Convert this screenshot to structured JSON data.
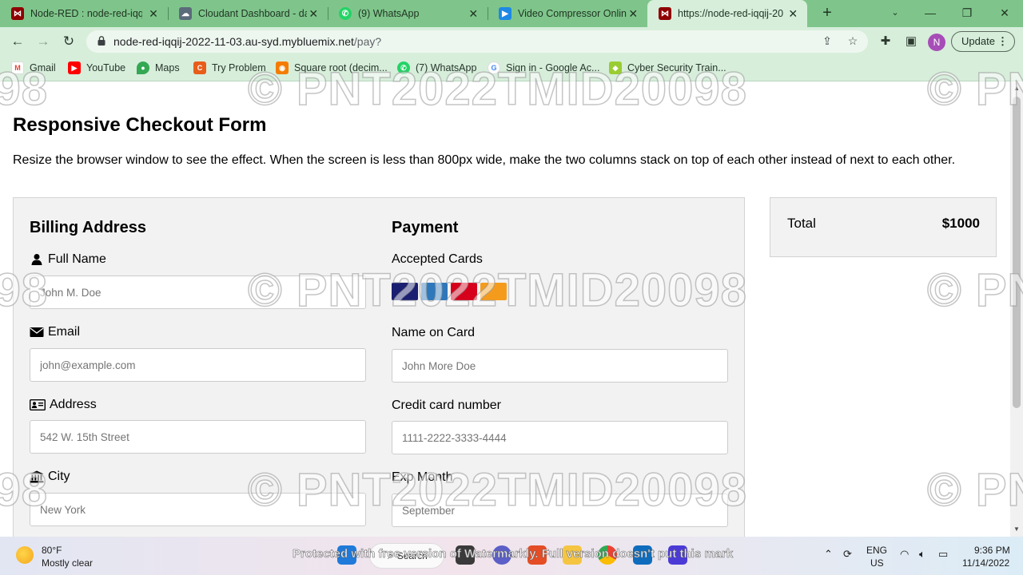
{
  "browser": {
    "tabs": [
      {
        "label": "Node-RED : node-red-iqqij",
        "icon": "node-red-icon",
        "color": "#8f0000"
      },
      {
        "label": "Cloudant Dashboard - dat",
        "icon": "cloudant-icon",
        "color": "#5a6b7a"
      },
      {
        "label": "(9) WhatsApp",
        "icon": "whatsapp-icon",
        "color": "#25d366"
      },
      {
        "label": "Video Compressor Online",
        "icon": "video-compressor-icon",
        "color": "#1e88e5"
      },
      {
        "label": "https://node-red-iqqij-20",
        "icon": "node-red-icon",
        "color": "#8f0000"
      }
    ],
    "url_host": "node-red-iqqij-2022-11-03.au-syd.mybluemix.net",
    "url_path": "/pay?",
    "profile_initial": "N",
    "update_label": "Update",
    "bookmarks": [
      {
        "label": "Gmail",
        "icon": "gmail-icon",
        "color": "#ea4335"
      },
      {
        "label": "YouTube",
        "icon": "youtube-icon",
        "color": "#ff0000"
      },
      {
        "label": "Maps",
        "icon": "maps-icon",
        "color": "#34a853"
      },
      {
        "label": "Try Problem",
        "icon": "codechef-icon",
        "color": "#e85d1a"
      },
      {
        "label": "Square root (decim...",
        "icon": "khan-icon",
        "color": "#f57c00"
      },
      {
        "label": "(7) WhatsApp",
        "icon": "whatsapp-icon",
        "color": "#25d366"
      },
      {
        "label": "Sign in - Google Ac...",
        "icon": "google-icon",
        "color": "#4285f4"
      },
      {
        "label": "Cyber Security Train...",
        "icon": "cyber-icon",
        "color": "#9acd32"
      }
    ]
  },
  "page": {
    "title": "Responsive Checkout Form",
    "intro": "Resize the browser window to see the effect. When the screen is less than 800px wide, make the two columns stack on top of each other instead of next to each other.",
    "billing": {
      "heading": "Billing Address",
      "full_name_label": "Full Name",
      "full_name_placeholder": "John M. Doe",
      "email_label": "Email",
      "email_placeholder": "john@example.com",
      "address_label": "Address",
      "address_placeholder": "542 W. 15th Street",
      "city_label": "City",
      "city_placeholder": "New York"
    },
    "payment": {
      "heading": "Payment",
      "accepted_cards_label": "Accepted Cards",
      "cards": [
        {
          "name": "VISA",
          "icon": "visa-icon",
          "color": "#1a1f71"
        },
        {
          "name": "AMEX",
          "icon": "amex-icon",
          "color": "#2e77bb"
        },
        {
          "name": "MC",
          "icon": "mastercard-icon",
          "color": "#d6001c"
        },
        {
          "name": "DISCOVER",
          "icon": "discover-icon",
          "color": "#f59b1c"
        }
      ],
      "name_on_card_label": "Name on Card",
      "name_on_card_placeholder": "John More Doe",
      "card_number_label": "Credit card number",
      "card_number_placeholder": "1111-2222-3333-4444",
      "exp_month_label": "Exp Month",
      "exp_month_placeholder": "September"
    },
    "total": {
      "label": "Total",
      "value": "$1000"
    }
  },
  "watermark": {
    "text": "© PNT2022TMID20098",
    "banner": "Protected with free version of Watermarkly. Full version doesn't put this mark"
  },
  "taskbar": {
    "temperature": "80°F",
    "weather": "Mostly clear",
    "search_label": "Search",
    "lang_top": "ENG",
    "lang_bottom": "US",
    "time": "9:36 PM",
    "date": "11/14/2022"
  }
}
